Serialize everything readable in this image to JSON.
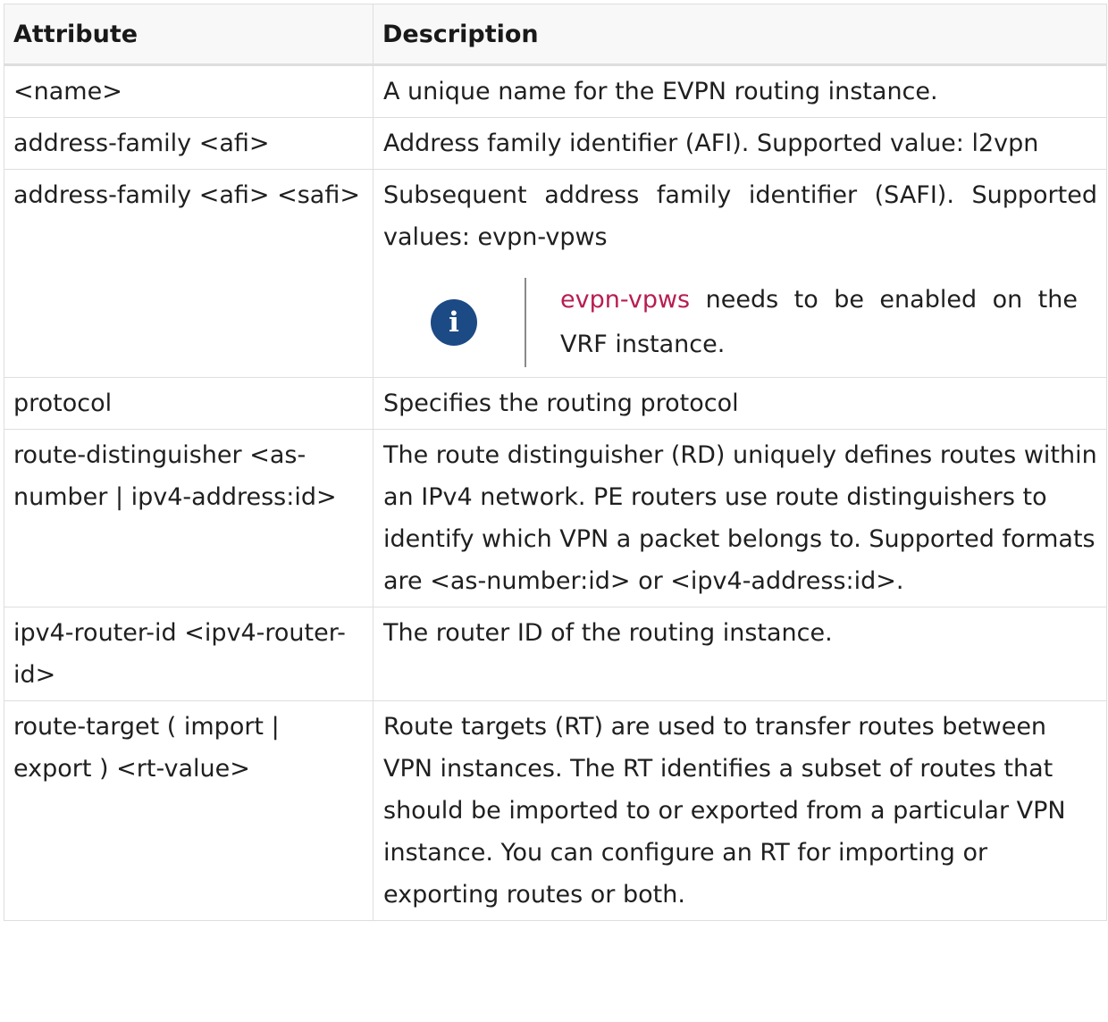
{
  "table": {
    "headers": {
      "attribute": "Attribute",
      "description": "Description"
    },
    "rows": [
      {
        "attribute": "<name>",
        "description": "A unique name for the EVPN routing instance."
      },
      {
        "attribute": "address-family <afi>",
        "description": "Address family identifier (AFI). Supported value: l2vpn"
      },
      {
        "attribute": "address-family <afi> <safi>",
        "description": "Subsequent address family identifier (SAFI). Supported values: evpn-vpws",
        "note": {
          "icon": "info-icon",
          "term": "evpn-vpws",
          "text": " needs to be enabled on the VRF instance."
        }
      },
      {
        "attribute": "protocol",
        "description": "Specifies the routing protocol"
      },
      {
        "attribute": "route-distinguisher <as-number | ipv4-address:id>",
        "description": "The route distinguisher (RD) uniquely defines routes within an IPv4 network. PE routers use route distinguishers to identify which VPN a packet belongs to. Supported formats are <as-number:id> or <ipv4-address:id>."
      },
      {
        "attribute": "ipv4-router-id <ipv4-router-id>",
        "description": "The router ID of the routing instance."
      },
      {
        "attribute": "route-target ( import | export ) <rt-value>",
        "description": "Route targets (RT) are used to transfer routes between VPN instances. The RT identifies a subset of routes that should be imported to or exported from a particular VPN instance. You can configure an RT for importing or exporting routes or both."
      }
    ]
  },
  "colors": {
    "note_icon_bg": "#1c4a85",
    "code_term": "#b81d4f",
    "header_bg": "#f7f8f7",
    "border": "#dedede"
  }
}
